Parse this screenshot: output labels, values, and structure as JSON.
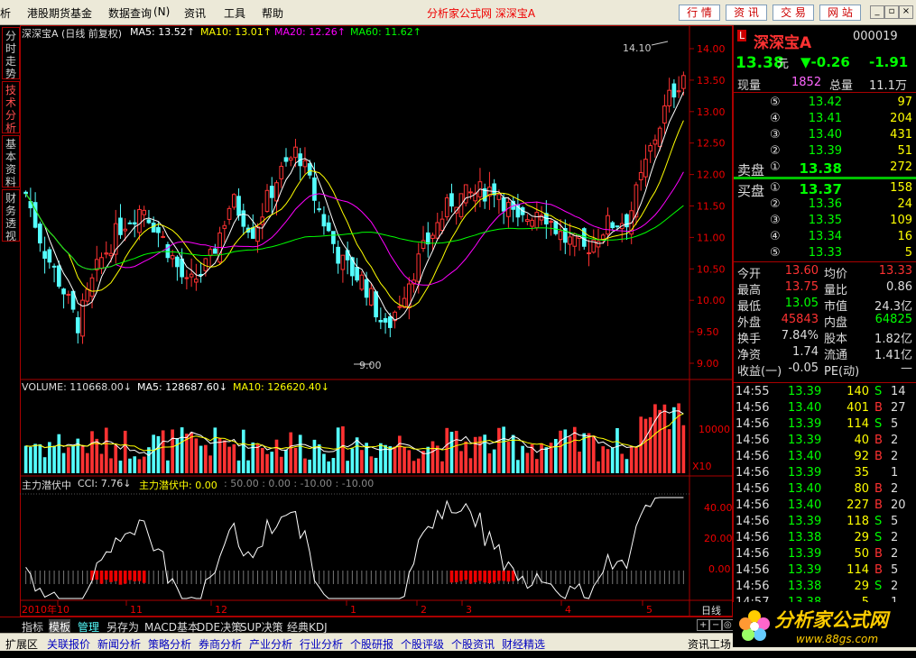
{
  "menubar": {
    "items": [
      "析",
      "港股期货基金",
      "数据查询",
      "资讯",
      "工具",
      "帮助"
    ],
    "shortcut": "(N)",
    "center_title": "分析家公式网  深深宝A",
    "top_buttons": [
      "行 情",
      "资 讯",
      "交 易",
      "网 站"
    ]
  },
  "left_tabs": [
    "分时走势",
    "技术分析",
    "基本资料",
    "财务透视"
  ],
  "main_legend": {
    "stock": "深深宝A (日线 前复权)",
    "ma5": "MA5: 13.52↑",
    "ma10": "MA10: 13.01↑",
    "ma20": "MA20: 12.26↑",
    "ma60": "MA60: 11.62↑",
    "high_label": "14.10",
    "low_label": "9.00"
  },
  "price_axis": [
    "14.00",
    "13.50",
    "13.00",
    "12.50",
    "12.00",
    "11.50",
    "11.00",
    "10.50",
    "10.00",
    "9.50",
    "9.00"
  ],
  "volume_legend": {
    "vol": "VOLUME: 110668.00↓",
    "ma5": "MA5: 128687.60↓",
    "ma10": "MA10: 126620.40↓",
    "axis": "10000",
    "unit": "X10"
  },
  "indicator_legend": {
    "name": "主力潜伏中",
    "cci": "CCI: 7.76↓",
    "value": "主力潜伏中: 0.00",
    "rest": ": 50.00 : 0.00 : -10.00 : -10.00",
    "axis": [
      "40.00",
      "20.00",
      "0.00"
    ]
  },
  "date_axis": [
    "2010年10",
    "11",
    "12",
    "1",
    "2",
    "3",
    "4",
    "5"
  ],
  "period": "日线",
  "right_panel": {
    "name": "深深宝A",
    "code": "000019",
    "price": "13.38",
    "price_unit": "元",
    "change": "▼-0.26",
    "pct": "-1.91",
    "now_vol_label": "现量",
    "now_vol": "1852",
    "total_vol_label": "总量",
    "total_vol": "11.1万",
    "asks": [
      {
        "lvl": "⑤",
        "price": "13.42",
        "vol": "97"
      },
      {
        "lvl": "④",
        "price": "13.41",
        "vol": "204"
      },
      {
        "lvl": "③",
        "price": "13.40",
        "vol": "431"
      },
      {
        "lvl": "②",
        "price": "13.39",
        "vol": "51"
      },
      {
        "lvl": "①",
        "price": "13.38",
        "vol": "272",
        "label": "卖盘"
      }
    ],
    "bids": [
      {
        "lvl": "①",
        "price": "13.37",
        "vol": "158",
        "label": "买盘"
      },
      {
        "lvl": "②",
        "price": "13.36",
        "vol": "24"
      },
      {
        "lvl": "③",
        "price": "13.35",
        "vol": "109"
      },
      {
        "lvl": "④",
        "price": "13.34",
        "vol": "16"
      },
      {
        "lvl": "⑤",
        "price": "13.33",
        "vol": "5"
      }
    ],
    "stats": [
      {
        "l1": "今开",
        "v1": "13.60",
        "l2": "均价",
        "v2": "13.33"
      },
      {
        "l1": "最高",
        "v1": "13.75",
        "l2": "量比",
        "v2": "0.86"
      },
      {
        "l1": "最低",
        "v1": "13.05",
        "l2": "市值",
        "v2": "24.3亿"
      },
      {
        "l1": "外盘",
        "v1": "45843",
        "l2": "内盘",
        "v2": "64825"
      },
      {
        "l1": "换手",
        "v1": "7.84%",
        "l2": "股本",
        "v2": "1.82亿"
      },
      {
        "l1": "净资",
        "v1": "1.74",
        "l2": "流通",
        "v2": "1.41亿"
      },
      {
        "l1": "收益(一)",
        "v1": "-0.05",
        "l2": "PE(动)",
        "v2": "—"
      }
    ],
    "ticks": [
      {
        "t": "14:55",
        "p": "13.39",
        "v": "140",
        "s": "S",
        "n": "14"
      },
      {
        "t": "14:56",
        "p": "13.40",
        "v": "401",
        "s": "B",
        "n": "27"
      },
      {
        "t": "14:56",
        "p": "13.39",
        "v": "114",
        "s": "S",
        "n": "5"
      },
      {
        "t": "14:56",
        "p": "13.39",
        "v": "40",
        "s": "B",
        "n": "2"
      },
      {
        "t": "14:56",
        "p": "13.40",
        "v": "92",
        "s": "B",
        "n": "2"
      },
      {
        "t": "14:56",
        "p": "13.39",
        "v": "35",
        "s": "",
        "n": "1"
      },
      {
        "t": "14:56",
        "p": "13.40",
        "v": "80",
        "s": "B",
        "n": "2"
      },
      {
        "t": "14:56",
        "p": "13.40",
        "v": "227",
        "s": "B",
        "n": "20"
      },
      {
        "t": "14:56",
        "p": "13.39",
        "v": "118",
        "s": "S",
        "n": "5"
      },
      {
        "t": "14:56",
        "p": "13.38",
        "v": "29",
        "s": "S",
        "n": "2"
      },
      {
        "t": "14:56",
        "p": "13.39",
        "v": "50",
        "s": "B",
        "n": "2"
      },
      {
        "t": "14:56",
        "p": "13.39",
        "v": "114",
        "s": "B",
        "n": "5"
      },
      {
        "t": "14:56",
        "p": "13.38",
        "v": "29",
        "s": "S",
        "n": "2"
      },
      {
        "t": "14:57",
        "p": "13.38",
        "v": "5",
        "s": "",
        "n": "1"
      }
    ]
  },
  "bottom_tabs": [
    "指标",
    "模板",
    "管理",
    "另存为",
    "MACD基本",
    "DDE决策",
    "SUP决策",
    "经典KDJ"
  ],
  "status_tabs": [
    "扩展区",
    "关联报价",
    "新闻分析",
    "策略分析",
    "券商分析",
    "产业分析",
    "行业分析",
    "个股研报",
    "个股评级",
    "个股资讯",
    "财经精选",
    "资讯工场"
  ],
  "logo": {
    "text": "分析家公式网",
    "url": "www.88gs.com"
  },
  "colors": {
    "up": "#ff3232",
    "down": "#54ffff",
    "ma5": "#ffffff",
    "ma10": "#ffff00",
    "ma20": "#ff00ff",
    "ma60": "#00ff00"
  }
}
